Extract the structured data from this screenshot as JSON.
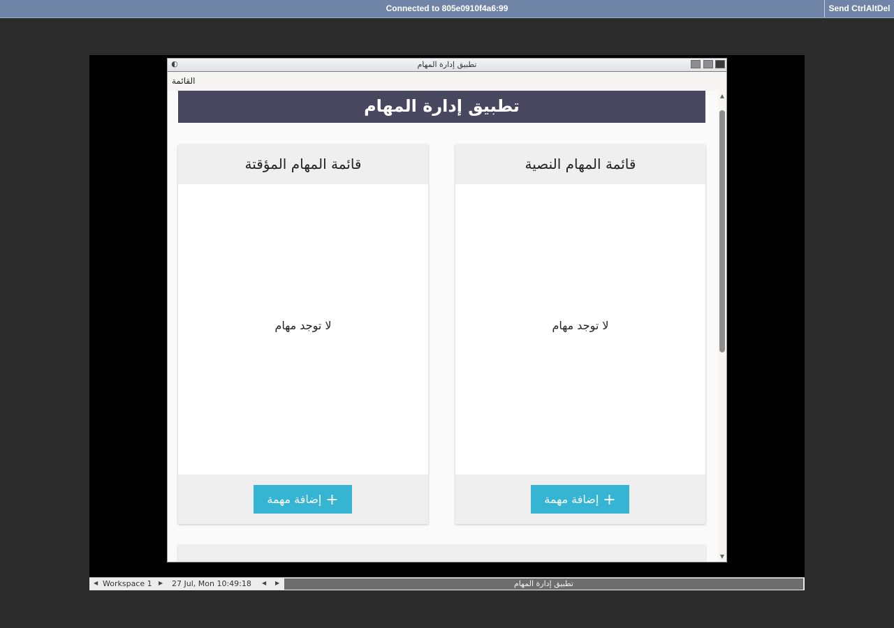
{
  "vnc": {
    "status": "Connected to 805e0910f4a6:99",
    "send_cad": "Send CtrlAltDel"
  },
  "window": {
    "title": "تطبيق إدارة المهام",
    "menu_label": "القائمة"
  },
  "app": {
    "header": "تطبيق إدارة المهام",
    "lists": [
      {
        "title": "قائمة المهام المؤقتة",
        "empty": "لا توجد مهام",
        "add_label": "إضافة مهمة",
        "add_icon": "+"
      },
      {
        "title": "قائمة المهام النصية",
        "empty": "لا توجد مهام",
        "add_label": "إضافة مهمة",
        "add_icon": "+"
      }
    ]
  },
  "taskbar": {
    "workspace": "Workspace 1",
    "datetime": "27 Jul, Mon 10:49:18",
    "task_title": "تطبيق إدارة المهام"
  },
  "colors": {
    "header_bg": "#474760",
    "button_bg": "#35b4d3",
    "vnc_bar": "#6f84a6"
  }
}
